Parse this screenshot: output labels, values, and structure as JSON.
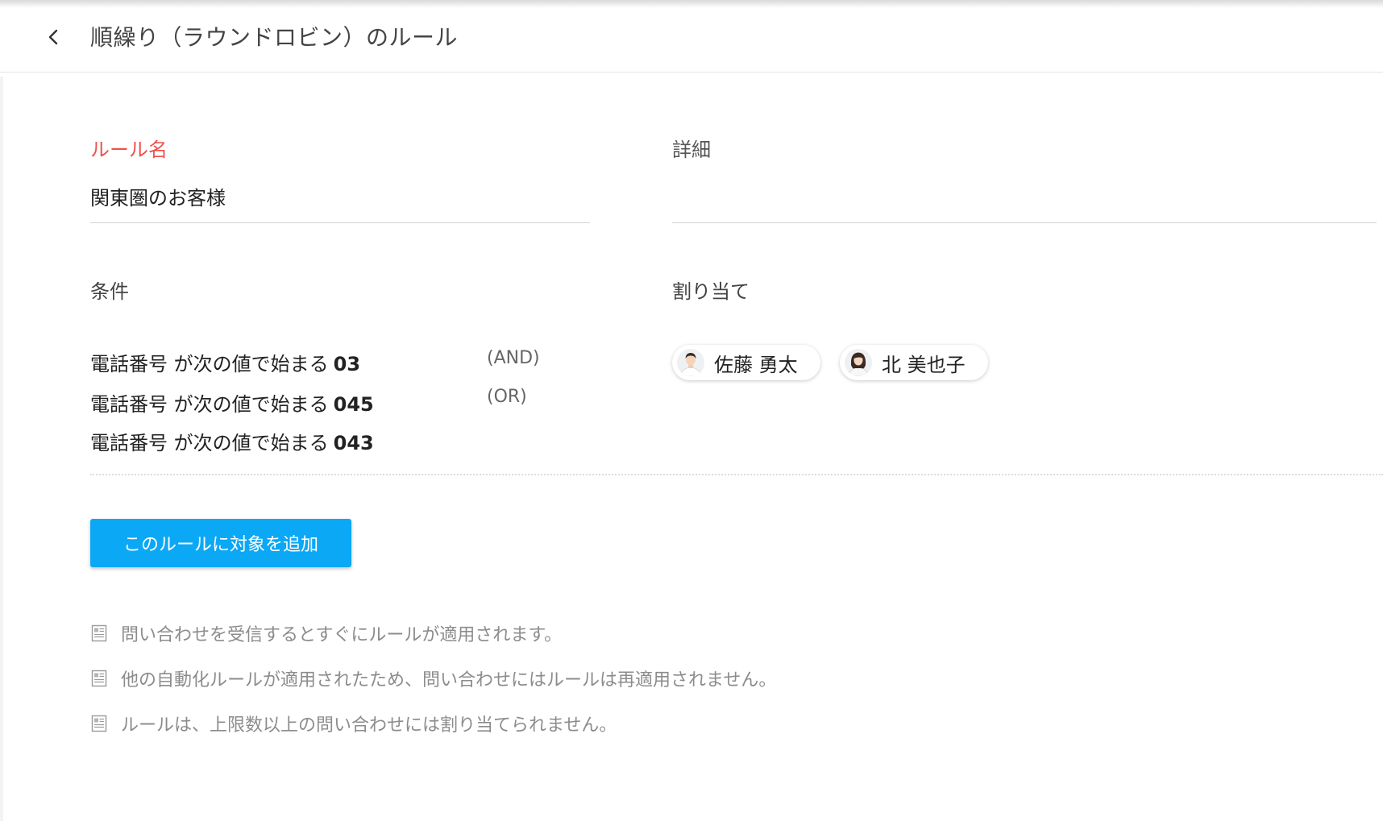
{
  "header": {
    "title": "順繰り（ラウンドロビン）のルール"
  },
  "form": {
    "rule_name_label": "ルール名",
    "rule_name_value": "関東圏のお客様",
    "details_label": "詳細",
    "details_value": "",
    "conditions_label": "条件",
    "assignment_label": "割り当て",
    "conditions": [
      {
        "text": "電話番号 が次の値で始まる",
        "value": "03"
      },
      {
        "text": "電話番号 が次の値で始まる",
        "value": "045"
      },
      {
        "text": "電話番号 が次の値で始まる",
        "value": "043"
      }
    ],
    "logic": [
      "(AND)",
      "(OR)"
    ],
    "assignees": [
      {
        "name": "佐藤 勇太",
        "avatar": "male-avatar"
      },
      {
        "name": "北 美也子",
        "avatar": "female-avatar"
      }
    ],
    "add_button_label": "このルールに対象を追加"
  },
  "notes": [
    "問い合わせを受信するとすぐにルールが適用されます。",
    "他の自動化ルールが適用されたため、問い合わせにはルールは再適用されません。",
    "ルールは、上限数以上の問い合わせには割り当てられません。"
  ],
  "colors": {
    "required_label": "#f0504a",
    "primary_button": "#0ba8f5"
  }
}
